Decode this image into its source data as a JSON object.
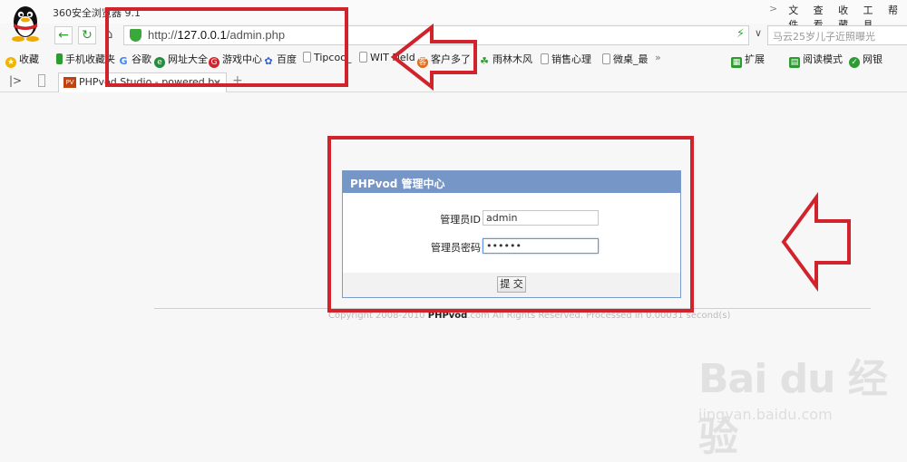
{
  "browser": {
    "title": "360安全浏览器 9.1",
    "menu": {
      "chevron": ">",
      "file": "文件",
      "view": "查看",
      "favorites": "收藏",
      "tools": "工具",
      "more": "帮"
    },
    "address": {
      "prefix": "http://",
      "host": "127.0.0.1",
      "path": "/admin.php",
      "dropdown": "∨"
    },
    "search_placeholder": "马云25岁儿子近照曝光",
    "bookmarks": [
      {
        "label": "收藏",
        "icon": "star-icon",
        "color": "#f0b400"
      },
      {
        "label": "手机收藏夹",
        "icon": "phone-icon",
        "color": "#2e9a32"
      },
      {
        "label": "谷歌",
        "icon": "google-icon",
        "color": "#4285f4"
      },
      {
        "label": "网址大全",
        "icon": "globe-icon",
        "color": "#1f8f3a"
      },
      {
        "label": "游戏中心",
        "icon": "game-icon",
        "color": "#d1232b"
      },
      {
        "label": "百度",
        "icon": "baidu-paw-icon",
        "color": "#2b5fd9"
      },
      {
        "label": "Tipcoo_",
        "icon": "page-icon",
        "color": "#999999"
      },
      {
        "label": "WIT Field",
        "icon": "page-icon",
        "color": "#999999"
      },
      {
        "label": "客户多了",
        "icon": "customer-icon",
        "color": "#e06b1c"
      },
      {
        "label": "雨林木风",
        "icon": "tree-icon",
        "color": "#2e9a32"
      },
      {
        "label": "销售心理",
        "icon": "page-icon",
        "color": "#999999"
      },
      {
        "label": "微桌_最",
        "icon": "page-icon",
        "color": "#999999"
      },
      {
        "label": "»",
        "icon": "more-icon",
        "color": "#777777"
      },
      {
        "label": "扩展",
        "icon": "extension-icon",
        "color": "#2e9a32"
      },
      {
        "label": "阅读模式",
        "icon": "reader-icon",
        "color": "#2e9a32"
      },
      {
        "label": "网银",
        "icon": "bank-icon",
        "color": "#2e9a32"
      }
    ],
    "tab": {
      "icon_text": "PV",
      "label": "PHPvod Studio - powered by",
      "close": "×",
      "new_tab": "+"
    }
  },
  "login": {
    "heading": "PHPvod 管理中心",
    "id_label": "管理员ID",
    "id_value": "admin",
    "password_label": "管理员密码",
    "password_value": "••••••",
    "submit": "提 交"
  },
  "footer": {
    "copyright": "Copyright 2008-2010",
    "brand": "PHPvod",
    "rest": ".com All Rights Reserved. Processed in 0.00031 second(s)"
  },
  "watermark": {
    "brand": "Bai du 经验",
    "url": "jingyan.baidu.com"
  },
  "annotation_color": "#d1232b"
}
